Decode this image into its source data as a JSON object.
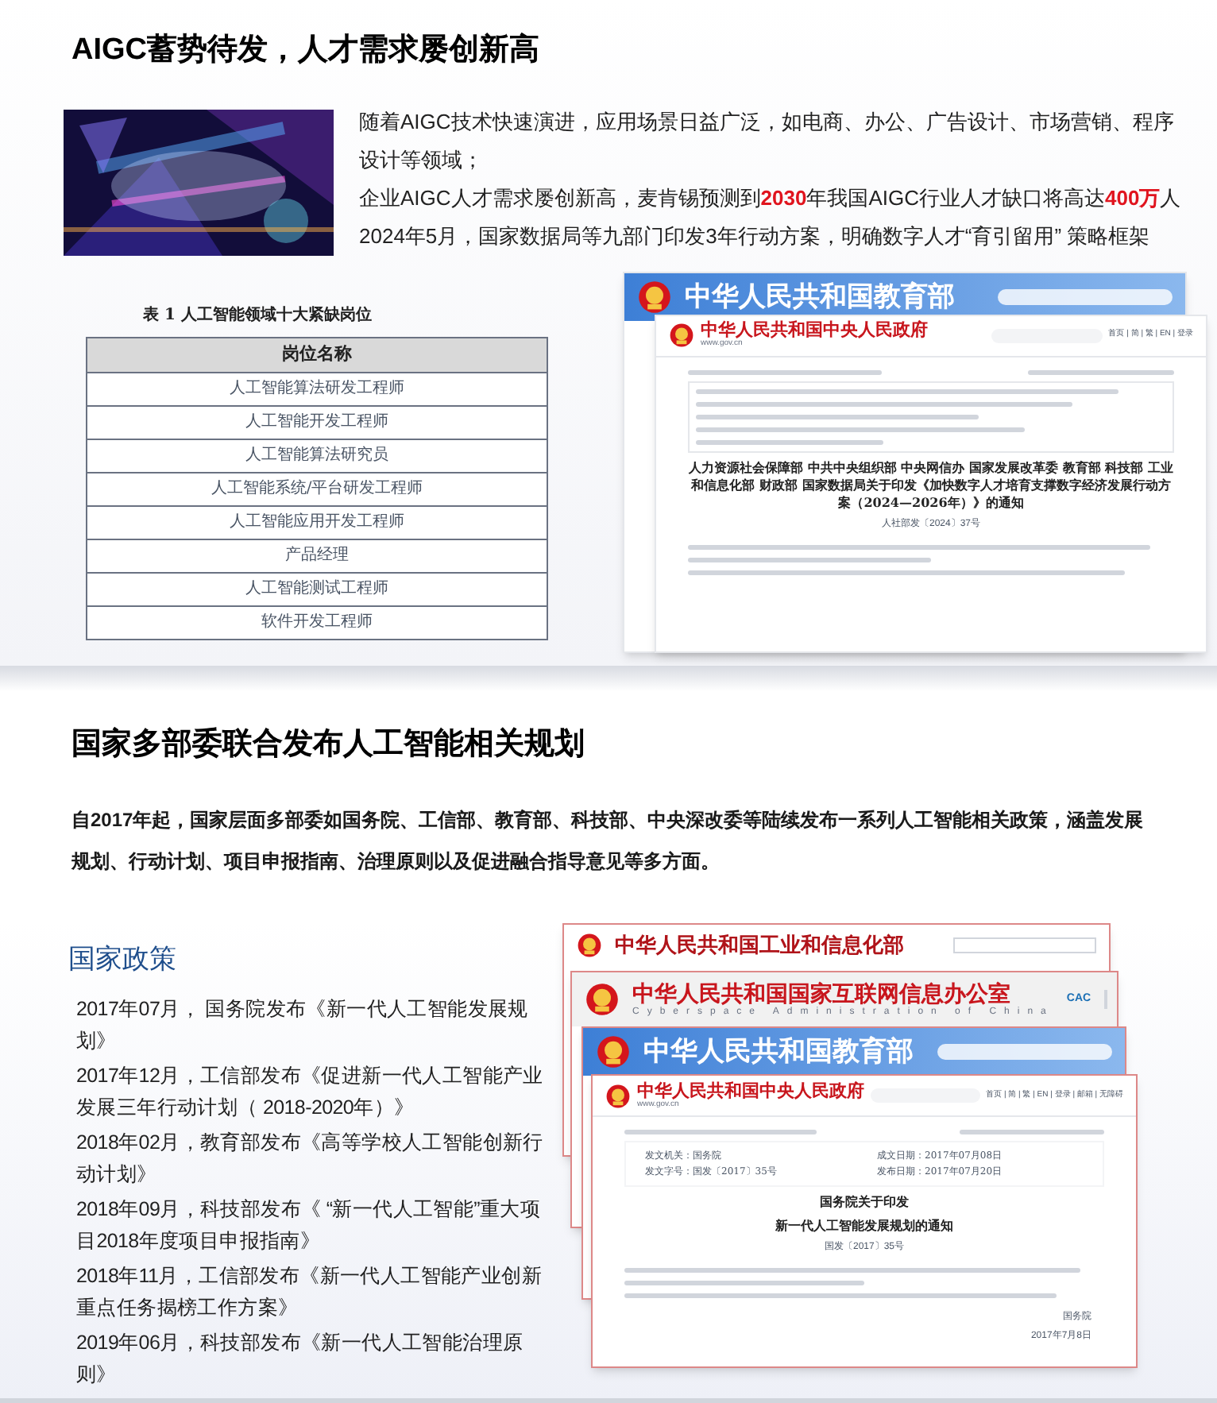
{
  "section1": {
    "title": "AIGC蓄势待发，人才需求屡创新高",
    "paragraphs": [
      "随着AIGC技术快速演进，应用场景日益广泛，如电商、办公、广告设计、市场营销、程序设计等领域；",
      "企业AIGC人才需求屡创新高，麦肯锡预测到**2030**年我国AIGC行业人才缺口将高达**400万**人",
      "2024年5月，国家数据局等九部门印发3年行动方案，明确数字人才“育引留用” 策略框架"
    ],
    "table": {
      "caption": "表 1 人工智能领域十大紧缺岗位",
      "header": "岗位名称",
      "rows": [
        "人工智能算法研发工程师",
        "人工智能开发工程师",
        "人工智能算法研究员",
        "人工智能系统/平台研发工程师",
        "人工智能应用开发工程师",
        "产品经理",
        "人工智能测试工程师",
        "软件开发工程师"
      ]
    },
    "screenshots": [
      {
        "kind": "blue",
        "site": "中华人民共和国教育部"
      },
      {
        "kind": "gov",
        "site": "中华人民共和国中央人民政府",
        "domain": "www.gov.cn",
        "nav": "首页 | 简 | 繁 | EN | 登录",
        "body": [
          {
            "kind": "meta_block"
          },
          {
            "kind": "heading",
            "text": "人力资源社会保障部 中共中央组织部 中央网信办 国家发展改革委 教育部 科技部 工业和信息化部 财政部 国家数据局关于印发《加快数字人才培育支撑数字经济发展行动方案（2024—2026年）》的通知"
          },
          {
            "kind": "number",
            "text": "人社部发〔2024〕37号"
          },
          {
            "kind": "lines"
          }
        ]
      }
    ]
  },
  "section2": {
    "title": "国家多部委联合发布人工智能相关规划",
    "intro": "自2017年起，国家层面多部委如国务院、工信部、教育部、科技部、中央深改委等陆续发布一系列人工智能相关政策，涵盖发展规划、行动计划、项目申报指南、治理原则以及促进融合指导意见等多方面。",
    "policy_heading": "国家政策",
    "policies": [
      "2017年07月， 国务院发布《新一代人工智能发展规划》",
      "2017年12月，工信部发布《促进新一代人工智能产业发展三年行动计划（ 2018-2020年）》",
      "2018年02月，教育部发布《高等学校人工智能创新行动计划》",
      "2018年09月，科技部发布《 “新一代人工智能”重大项目2018年度项目申报指南》",
      "2018年11月，工信部发布《新一代人工智能产业创新重点任务揭榜工作方案》",
      "2019年06月，科技部发布《新一代人工智能治理原则》"
    ],
    "screenshots": [
      {
        "kind": "white",
        "site": "中华人民共和国工业和信息化部"
      },
      {
        "kind": "grey",
        "site": "中华人民共和国国家互联网信息办公室",
        "subtitle": "Cyberspace Administration of China",
        "badge": "CAC"
      },
      {
        "kind": "blue",
        "site": "中华人民共和国教育部"
      },
      {
        "kind": "gov",
        "site": "中华人民共和国中央人民政府",
        "domain": "www.gov.cn",
        "nav": "首页 | 简 | 繁 | EN | 登录 | 邮箱 | 无障碍",
        "body": [
          {
            "kind": "meta",
            "pairs": [
              [
                "发文机关：",
                "国务院"
              ],
              [
                "成文日期：",
                "2017年07月08日"
              ],
              [
                "发文字号：",
                "国发〔2017〕35号"
              ],
              [
                "发布日期：",
                "2017年07月20日"
              ]
            ]
          },
          {
            "kind": "heading",
            "text": "国务院关于印发"
          },
          {
            "kind": "heading",
            "text": "新一代人工智能发展规划的通知"
          },
          {
            "kind": "number",
            "text": "国发〔2017〕35号"
          },
          {
            "kind": "lines"
          },
          {
            "kind": "sign",
            "text": "国务院"
          },
          {
            "kind": "sign",
            "text": "2017年7月8日"
          }
        ]
      }
    ]
  }
}
